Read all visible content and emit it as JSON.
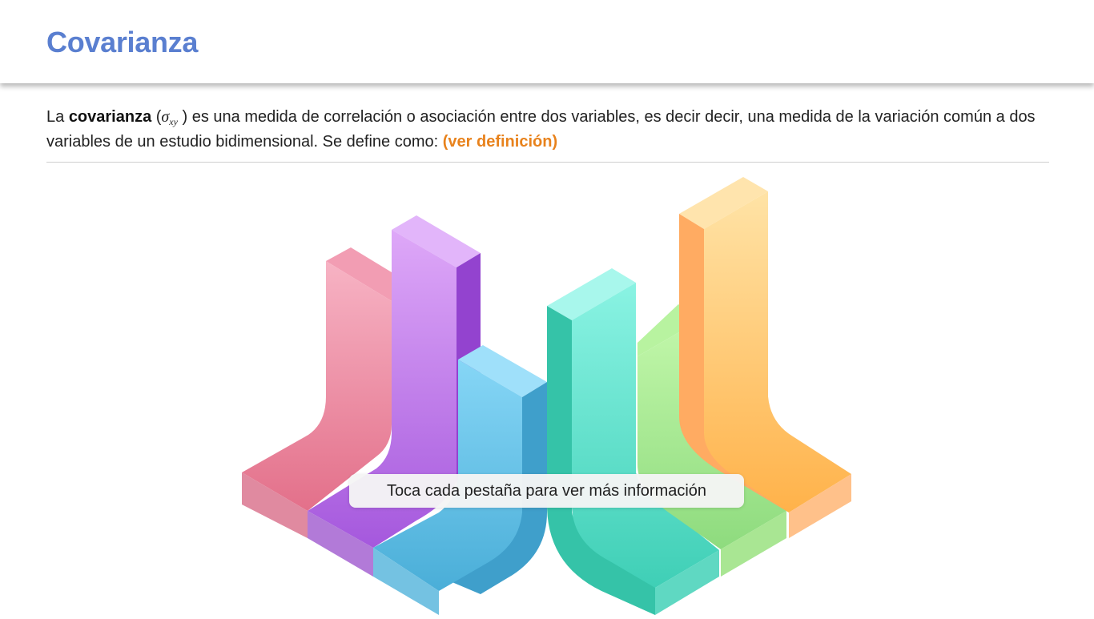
{
  "header": {
    "title": "Covarianza"
  },
  "intro": {
    "prefix": "La ",
    "term": "covarianza",
    "paren_open": " (",
    "symbol": "σ",
    "symbol_sub": "xy",
    "paren_close": " )",
    "text": " es una medida de correlación o asociación entre dos variables, es decir decir, una medida de la variación común a dos variables de un estudio bidimensional. Se define como: ",
    "link": "(ver definición)"
  },
  "hint": {
    "text": "Toca cada pestaña para ver más información"
  },
  "colors": {
    "title": "#5a7fd0",
    "link": "#e8821c",
    "tab_pink": "#f07a96",
    "tab_purple": "#b060e0",
    "tab_blue": "#50b4e0",
    "tab_teal": "#40d0b8",
    "tab_green": "#90e080",
    "tab_orange": "#ffb040"
  }
}
